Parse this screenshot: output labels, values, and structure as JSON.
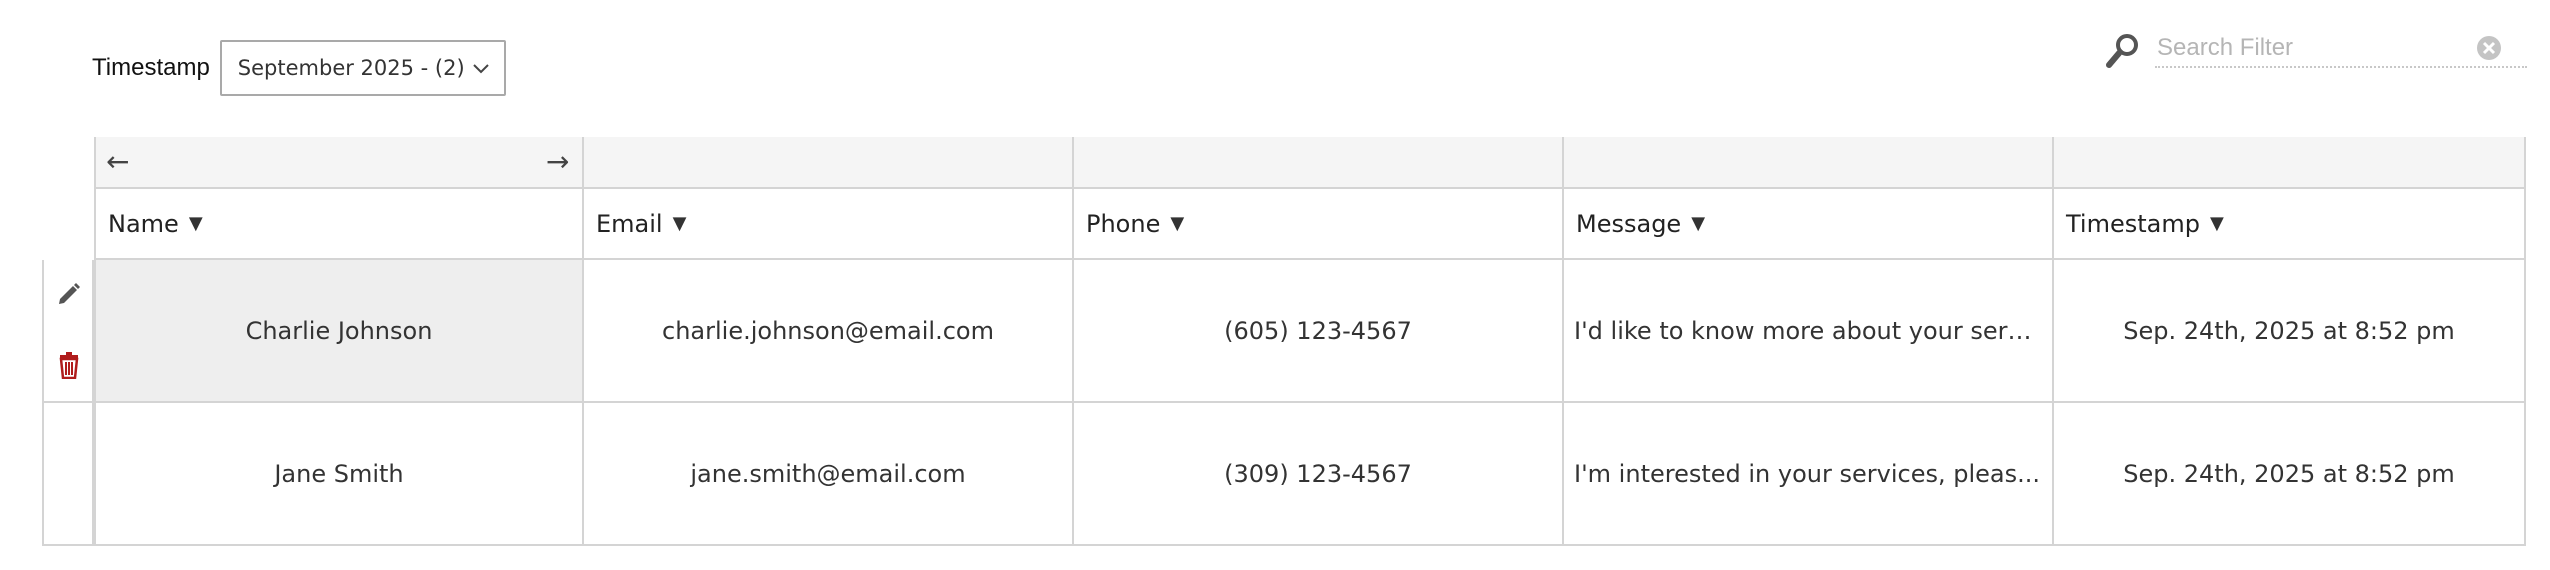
{
  "toolbar": {
    "filter_label": "Timestamp",
    "filter_select": "September 2025 - (2)",
    "search_placeholder": "Search Filter"
  },
  "table": {
    "nav": {
      "prev_icon": "arrow-left-icon",
      "next_icon": "arrow-right-icon",
      "prev": "←",
      "next": "→"
    },
    "sort_glyph": "▼",
    "columns": [
      {
        "label": "Name"
      },
      {
        "label": "Email"
      },
      {
        "label": "Phone"
      },
      {
        "label": "Message"
      },
      {
        "label": "Timestamp"
      }
    ],
    "rows": [
      {
        "name": "Charlie Johnson",
        "email": "charlie.johnson@email.com",
        "phone": "(605) 123-4567",
        "message": "I'd like to know more about your serv...",
        "timestamp": "Sep. 24th, 2025 at 8:52 pm"
      },
      {
        "name": "Jane Smith",
        "email": "jane.smith@email.com",
        "phone": "(309) 123-4567",
        "message": "I'm interested in your services, pleas...",
        "timestamp": "Sep. 24th, 2025 at 8:52 pm"
      }
    ]
  },
  "icons": {
    "search": "search-icon",
    "clear": "clear-icon",
    "edit": "pencil-icon",
    "delete": "trash-icon",
    "dropdown": "chevron-down-icon"
  },
  "colors": {
    "delete": "#b01c1c",
    "edit": "#555555",
    "selected_cell": "#eeeeee",
    "header_bg": "#f5f5f5",
    "border": "#d4d4d4"
  }
}
